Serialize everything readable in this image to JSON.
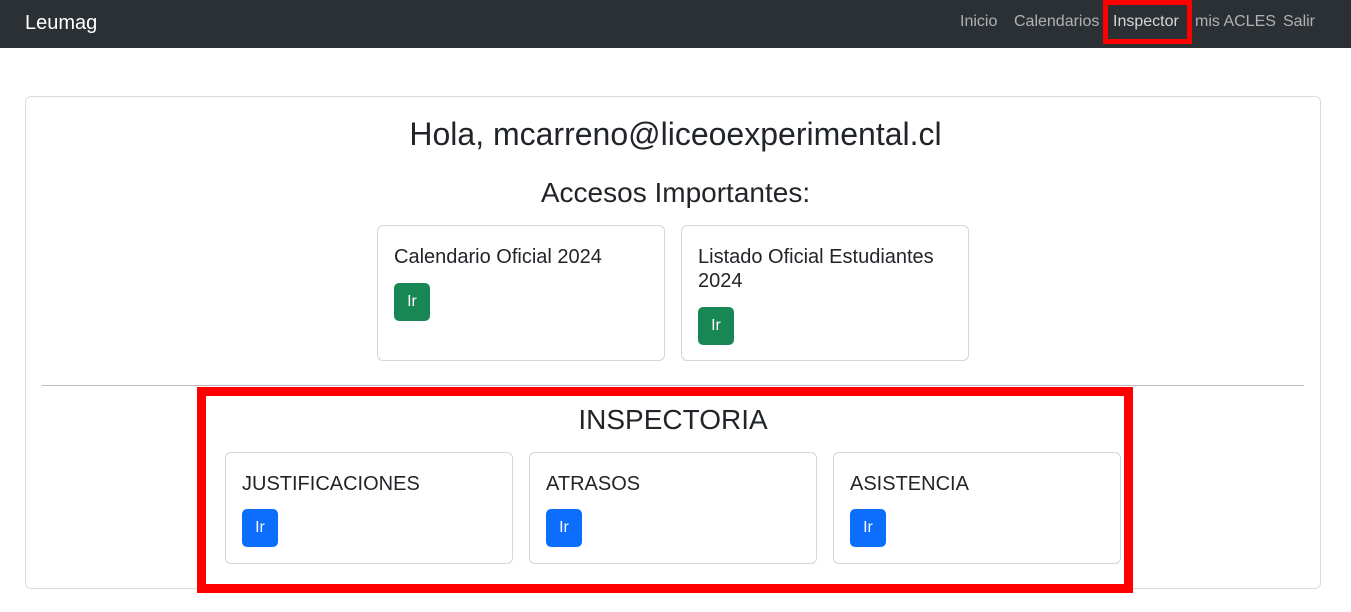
{
  "navbar": {
    "brand": "Leumag",
    "links": [
      {
        "label": "Inicio"
      },
      {
        "label": "Calendarios"
      },
      {
        "label": "Inspector"
      },
      {
        "label": "mis ACLES"
      },
      {
        "label": "Salir"
      }
    ]
  },
  "main": {
    "greeting": "Hola, mcarreno@liceoexperimental.cl",
    "accesos_title": "Accesos Importantes:",
    "accesos": [
      {
        "title": "Calendario Oficial 2024",
        "button": "Ir"
      },
      {
        "title": "Listado Oficial Estudiantes 2024",
        "button": "Ir"
      }
    ],
    "inspectoria_title": "INSPECTORIA",
    "inspectoria": [
      {
        "title": "JUSTIFICACIONES",
        "button": "Ir"
      },
      {
        "title": "ATRASOS",
        "button": "Ir"
      },
      {
        "title": "ASISTENCIA",
        "button": "Ir"
      }
    ]
  },
  "colors": {
    "navbar_bg": "#2b3035",
    "success": "#198754",
    "primary": "#0d6efd",
    "highlight": "#ff0000"
  }
}
